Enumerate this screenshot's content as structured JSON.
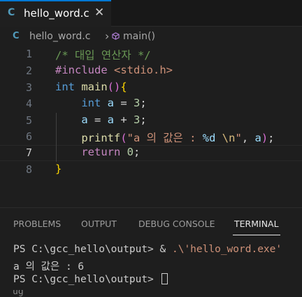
{
  "tab": {
    "icon_letter": "C",
    "label": "hello_word.c",
    "close_glyph": "✕"
  },
  "breadcrumb": {
    "icon_letter": "C",
    "file": "hello_word.c",
    "separator": "›",
    "symbol": "main()"
  },
  "editor": {
    "active_line": 7,
    "lines": [
      {
        "num": "1"
      },
      {
        "num": "2"
      },
      {
        "num": "3"
      },
      {
        "num": "4"
      },
      {
        "num": "5"
      },
      {
        "num": "6"
      },
      {
        "num": "7"
      },
      {
        "num": "8"
      }
    ],
    "tokens": {
      "comment": "/* 대입 연산자 */",
      "include_kw": "#include",
      "include_hdr": "<stdio.h>",
      "type_int": "int",
      "main_fn": "main",
      "var_a": "a",
      "num_3": "3",
      "num_0": "0",
      "printf_fn": "printf",
      "str_open": "\"a 의 값은 : ",
      "fmt": "%d",
      "esc": "\\n",
      "str_close": "\"",
      "return_kw": "return"
    }
  },
  "panel": {
    "tabs": [
      "PROBLEMS",
      "OUTPUT",
      "DEBUG CONSOLE",
      "TERMINAL"
    ],
    "active_tab": "TERMINAL",
    "terminal": {
      "line1_prompt": "PS C:\\gcc_hello\\output> & ",
      "line1_cmd": ".\\'hello_word.exe'",
      "line2": "a 의 값은 : 6",
      "line3_prompt": "PS C:\\gcc_hello\\output> ",
      "partial_line": "ug"
    }
  },
  "colors": {
    "background": "#1e1e1e",
    "accent": "#0078d4",
    "c_icon": "#519aba"
  }
}
